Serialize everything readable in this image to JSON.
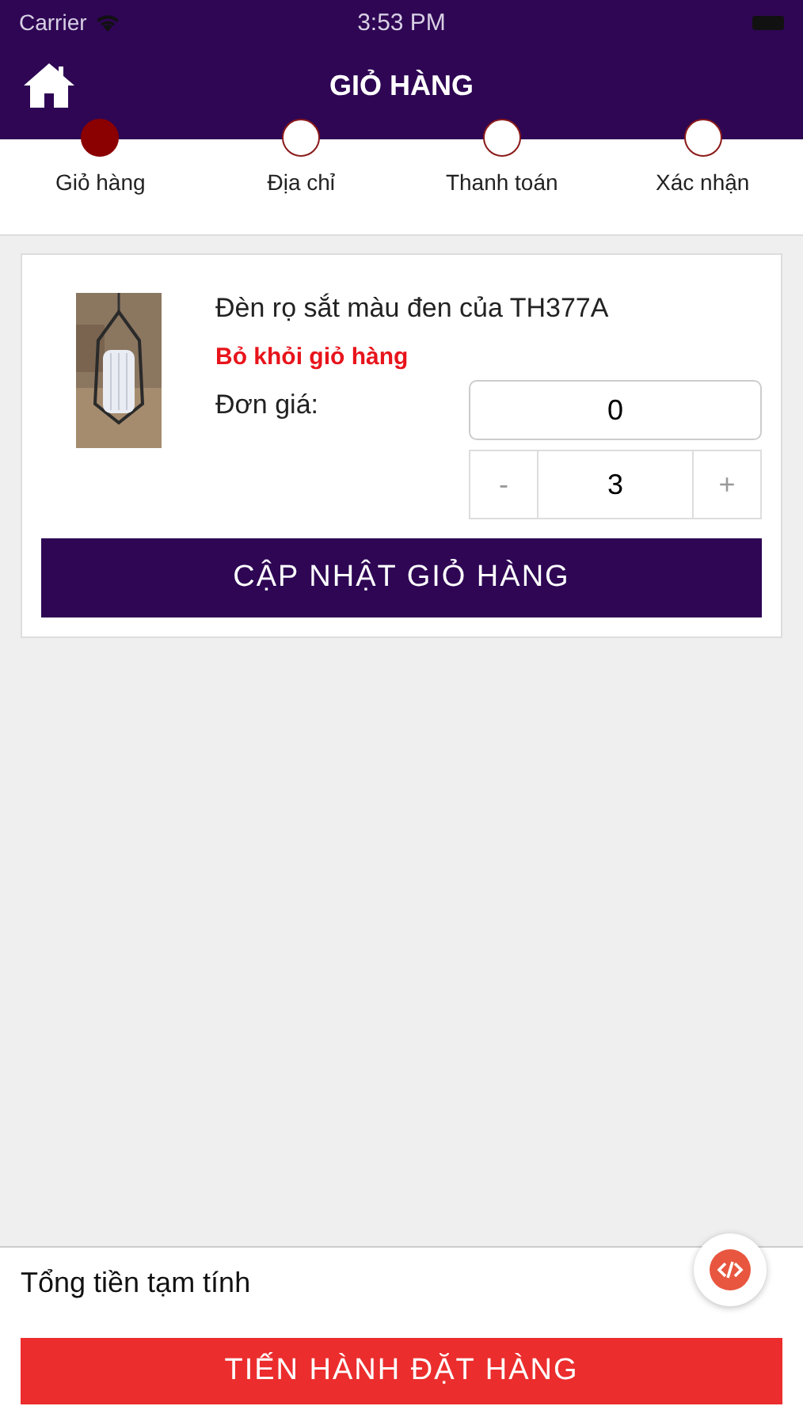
{
  "status_bar": {
    "carrier": "Carrier",
    "time": "3:53 PM"
  },
  "header": {
    "title": "GIỎ HÀNG"
  },
  "steps": [
    {
      "label": "Giỏ hàng",
      "selected": true
    },
    {
      "label": "Địa chỉ",
      "selected": false
    },
    {
      "label": "Thanh toán",
      "selected": false
    },
    {
      "label": "Xác nhận",
      "selected": false
    }
  ],
  "cart_items": [
    {
      "kind": "picture",
      "name": "Đèn rọ sắt màu đen của TH377A",
      "remove_link": "Bỏ khỏi giỏ hàng",
      "price_label": "Đơn giá:",
      "price": "0",
      "decrement": "-",
      "quantity": "3",
      "increment": "+"
    }
  ],
  "update_button": "CẬP NHẬT GIỎ HÀNG",
  "footer": {
    "subtotal_label": "Tổng tiền tạm tính",
    "checkout_button": "TIẾN HÀNH ĐẶT HÀNG"
  }
}
